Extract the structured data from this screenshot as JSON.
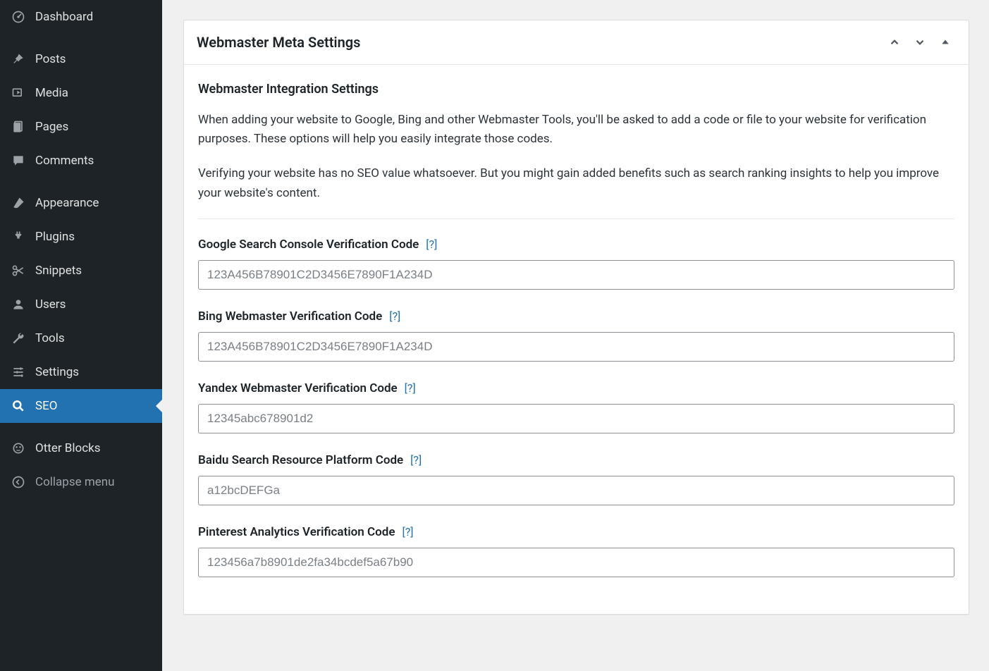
{
  "sidebar": {
    "items": [
      {
        "id": "dashboard",
        "label": "Dashboard",
        "icon": "dashboard-icon"
      },
      {
        "id": "posts",
        "label": "Posts",
        "icon": "pin-icon"
      },
      {
        "id": "media",
        "label": "Media",
        "icon": "media-icon"
      },
      {
        "id": "pages",
        "label": "Pages",
        "icon": "pages-icon"
      },
      {
        "id": "comments",
        "label": "Comments",
        "icon": "comments-icon"
      },
      {
        "id": "appearance",
        "label": "Appearance",
        "icon": "brush-icon"
      },
      {
        "id": "plugins",
        "label": "Plugins",
        "icon": "plug-icon"
      },
      {
        "id": "snippets",
        "label": "Snippets",
        "icon": "scissors-icon"
      },
      {
        "id": "users",
        "label": "Users",
        "icon": "user-icon"
      },
      {
        "id": "tools",
        "label": "Tools",
        "icon": "wrench-icon"
      },
      {
        "id": "settings",
        "label": "Settings",
        "icon": "sliders-icon"
      },
      {
        "id": "seo",
        "label": "SEO",
        "icon": "search-icon",
        "active": true
      },
      {
        "id": "otter",
        "label": "Otter Blocks",
        "icon": "otter-icon"
      },
      {
        "id": "collapse",
        "label": "Collapse menu",
        "icon": "collapse-icon",
        "collapse": true
      }
    ]
  },
  "panel": {
    "title": "Webmaster Meta Settings",
    "section_title": "Webmaster Integration Settings",
    "description1": "When adding your website to Google, Bing and other Webmaster Tools, you'll be asked to add a code or file to your website for verification purposes. These options will help you easily integrate those codes.",
    "description2": "Verifying your website has no SEO value whatsoever. But you might gain added benefits such as search ranking insights to help you improve your website's content.",
    "help_label": "[?]",
    "fields": [
      {
        "id": "google",
        "label": "Google Search Console Verification Code",
        "placeholder": "123A456B78901C2D3456E7890F1A234D",
        "value": ""
      },
      {
        "id": "bing",
        "label": "Bing Webmaster Verification Code",
        "placeholder": "123A456B78901C2D3456E7890F1A234D",
        "value": ""
      },
      {
        "id": "yandex",
        "label": "Yandex Webmaster Verification Code",
        "placeholder": "12345abc678901d2",
        "value": ""
      },
      {
        "id": "baidu",
        "label": "Baidu Search Resource Platform Code",
        "placeholder": "a12bcDEFGa",
        "value": ""
      },
      {
        "id": "pinterest",
        "label": "Pinterest Analytics Verification Code",
        "placeholder": "123456a7b8901de2fa34bcdef5a67b90",
        "value": ""
      }
    ]
  }
}
